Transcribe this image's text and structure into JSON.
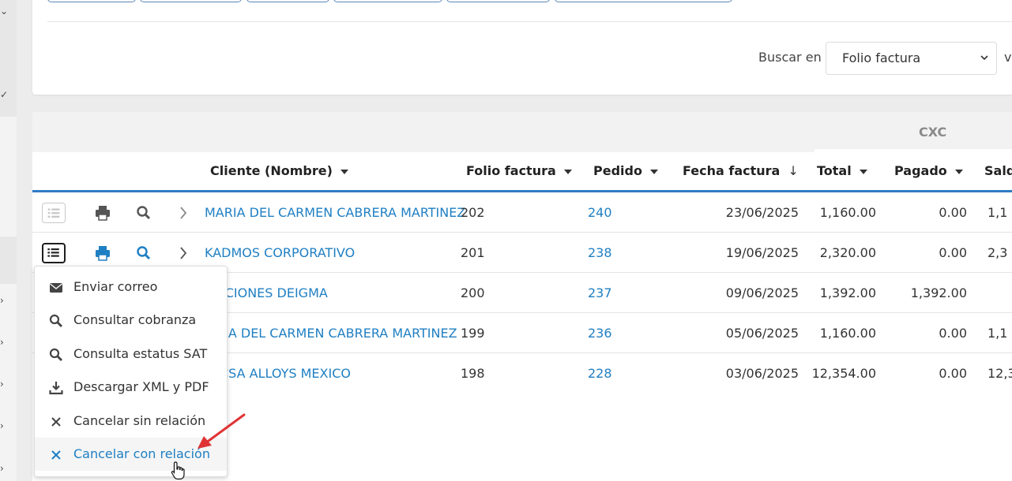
{
  "filters": {
    "search_label": "Buscar en",
    "search_select_value": "Folio factura",
    "trailing_text": "v"
  },
  "table": {
    "group_header": "CXC",
    "columns": [
      {
        "label": "Cliente (Nombre)",
        "sort": "menu"
      },
      {
        "label": "Folio factura",
        "sort": "menu"
      },
      {
        "label": "Pedido",
        "sort": "menu"
      },
      {
        "label": "Fecha factura",
        "sort": "desc"
      },
      {
        "label": "Total",
        "sort": "menu"
      },
      {
        "label": "Pagado",
        "sort": "menu"
      },
      {
        "label": "Sald",
        "sort": "none"
      }
    ],
    "rows": [
      {
        "cliente": "MARIA DEL CARMEN CABRERA MARTINEZ",
        "folio": "202",
        "pedido": "240",
        "fecha": "23/06/2025",
        "total": "1,160.00",
        "pagado": "0.00",
        "saldo": "1,1"
      },
      {
        "cliente": "KADMOS CORPORATIVO",
        "folio": "201",
        "pedido": "238",
        "fecha": "19/06/2025",
        "total": "2,320.00",
        "pagado": "0.00",
        "saldo": "2,3"
      },
      {
        "cliente": "UCIONES DEIGMA",
        "folio": "200",
        "pedido": "237",
        "fecha": "09/06/2025",
        "total": "1,392.00",
        "pagado": "1,392.00",
        "saldo": ""
      },
      {
        "cliente": "RIA DEL CARMEN CABRERA MARTINEZ",
        "folio": "199",
        "pedido": "236",
        "fecha": "05/06/2025",
        "total": "1,160.00",
        "pagado": "0.00",
        "saldo": "1,1"
      },
      {
        "cliente": "CSA ALLOYS MEXICO",
        "folio": "198",
        "pedido": "228",
        "fecha": "03/06/2025",
        "total": "12,354.00",
        "pagado": "0.00",
        "saldo": "12,3"
      }
    ]
  },
  "row_actions": {
    "icons": [
      "list-icon",
      "print-icon",
      "search-icon",
      "chevron-right-icon"
    ]
  },
  "context_menu": {
    "items": [
      {
        "label": "Enviar correo",
        "icon": "envelope-icon"
      },
      {
        "label": "Consultar cobranza",
        "icon": "search-icon"
      },
      {
        "label": "Consulta estatus SAT",
        "icon": "search-icon"
      },
      {
        "label": "Descargar XML y PDF",
        "icon": "download-icon"
      },
      {
        "label": "Cancelar sin relación",
        "icon": "close-icon"
      },
      {
        "label": "Cancelar con relación",
        "icon": "close-icon"
      }
    ]
  },
  "colors": {
    "accent": "#1f7fc3",
    "annotation_arrow": "#e03434"
  }
}
